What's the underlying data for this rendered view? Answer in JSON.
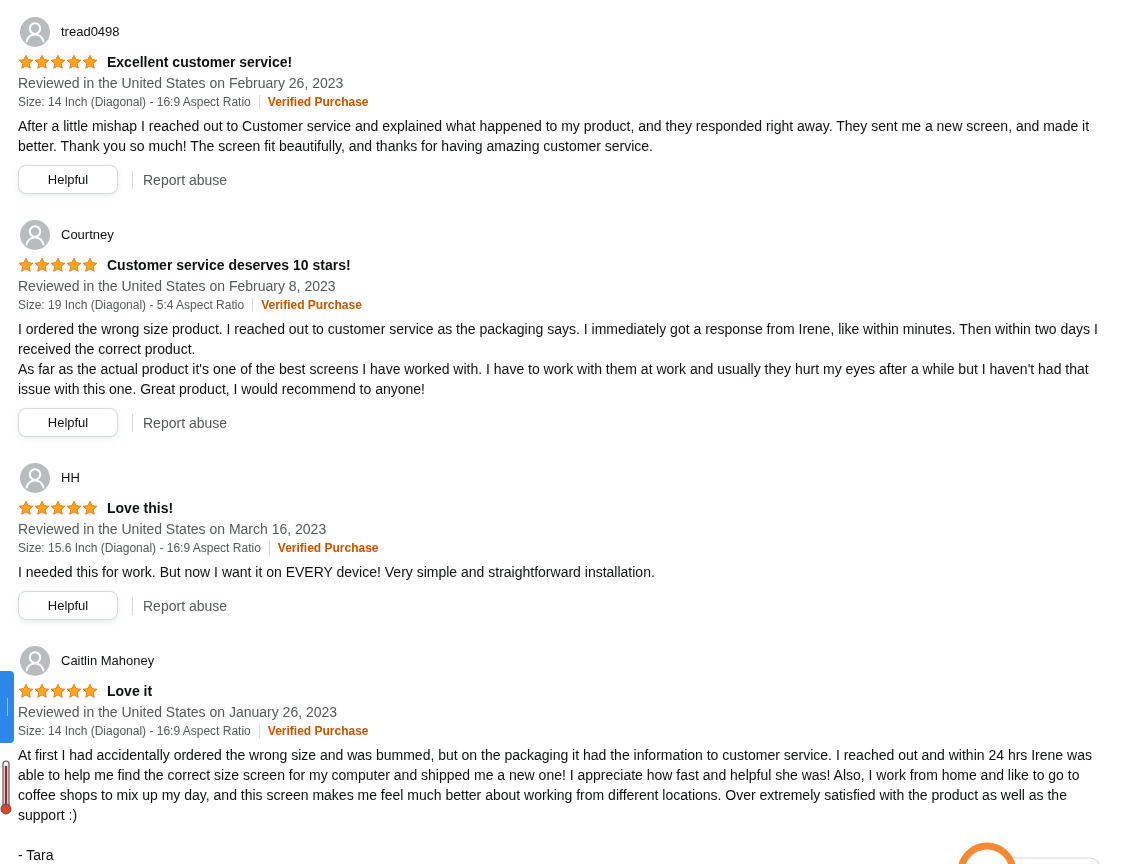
{
  "reviews": [
    {
      "reviewer": "tread0498",
      "stars": 5,
      "title": "Excellent customer service!",
      "date_line": "Reviewed in the United States on February 26, 2023",
      "variant": "Size: 14 Inch (Diagonal) - 16:9 Aspect Ratio",
      "badge": "Verified Purchase",
      "body": "After a little mishap I reached out to Customer service and explained what happened to my product, and they responded right away. They sent me a new screen, and made it better. Thank you so much! The screen fit beautifully, and thanks for having amazing customer service.",
      "helpful_button": "Helpful",
      "report_link": "Report abuse"
    },
    {
      "reviewer": "Courtney",
      "stars": 5,
      "title": "Customer service deserves 10 stars!",
      "date_line": "Reviewed in the United States on February 8, 2023",
      "variant": "Size: 19 Inch (Diagonal) - 5:4 Aspect Ratio",
      "badge": "Verified Purchase",
      "body": "I ordered the wrong size product. I reached out to customer service as the packaging says. I immediately got a response from Irene, like within minutes. Then within two days I received the correct product.\nAs far as the actual product it's one of the best screens I have worked with. I have to work with them at work and usually they hurt my eyes after a while but I haven't had that issue with this one. Great product, I would recommend to anyone!",
      "helpful_button": "Helpful",
      "report_link": "Report abuse"
    },
    {
      "reviewer": "HH",
      "stars": 5,
      "title": "Love this!",
      "date_line": "Reviewed in the United States on March 16, 2023",
      "variant": "Size: 15.6 Inch (Diagonal) - 16:9 Aspect Ratio",
      "badge": "Verified Purchase",
      "body": "I needed this for work. But now I want it on EVERY device! Very simple and straightforward installation.",
      "helpful_button": "Helpful",
      "report_link": "Report abuse"
    },
    {
      "reviewer": "Caitlin Mahoney",
      "stars": 5,
      "title": "Love it",
      "date_line": "Reviewed in the United States on January 26, 2023",
      "variant": "Size: 14 Inch (Diagonal) - 16:9 Aspect Ratio",
      "badge": "Verified Purchase",
      "body": "At first I had accidentally ordered the wrong size and was bummed, but on the packaging it had the information to customer service. I reached out and within 24 hrs Irene was able to help me find the correct size screen for my computer and shipped me a new one! I appreciate how fast and helpful she was! Also, I work from home and like to go to coffee shops to mix up my day, and this screen makes me feel much better about working from different locations. Over extremely satisfied with the product as well as the support :)",
      "signature": "- Tara"
    }
  ]
}
